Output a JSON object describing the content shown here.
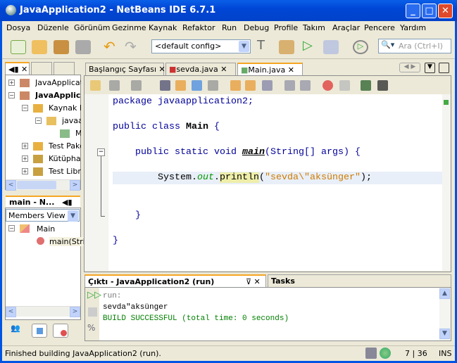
{
  "window": {
    "title": "JavaApplication2 - NetBeans IDE 6.7.1"
  },
  "menu": [
    "Dosya",
    "Düzenle",
    "Görünüm",
    "Gezinme",
    "Kaynak",
    "Refaktor",
    "Run",
    "Debug",
    "Profile",
    "Takım",
    "Araçlar",
    "Pencere",
    "Yardım"
  ],
  "toolbar": {
    "config": "<default config>",
    "search_placeholder": "Ara (Ctrl+I)"
  },
  "projects": {
    "items": [
      "JavaApplicati",
      "JavaApplic",
      "Kaynak P",
      "javaa",
      "M",
      "Test Pake",
      "Kütüphar",
      "Test Libra"
    ]
  },
  "navigator": {
    "title": "main - N...",
    "view": "Members View",
    "items": [
      "Main",
      "main(Stri"
    ]
  },
  "editor": {
    "tabs": [
      "Başlangıç Sayfası",
      "sevda.java",
      "Main.java"
    ],
    "active_tab": "Main.java"
  },
  "code": [
    [
      {
        "t": "package javaapplication2;",
        "c": "kw"
      }
    ],
    [],
    [
      {
        "t": "public class ",
        "c": "kw"
      },
      {
        "t": "Main",
        "c": "b"
      },
      {
        "t": " {",
        "c": "kw"
      }
    ],
    [],
    [
      {
        "t": "    public static void ",
        "c": "kw"
      },
      {
        "t": "main",
        "c": "bi"
      },
      {
        "t": "(String[] args) {",
        "c": "kw"
      }
    ],
    [],
    [
      {
        "t": "        System.",
        "c": ""
      },
      {
        "t": "out",
        "c": "it"
      },
      {
        "t": ".",
        "c": ""
      },
      {
        "t": "println",
        "c": "hl"
      },
      {
        "t": "(",
        "c": ""
      },
      {
        "t": "\"sevda\\\"aksünger\"",
        "c": "str"
      },
      {
        "t": ");",
        "c": ""
      }
    ],
    [],
    [],
    [
      {
        "t": "    }",
        "c": "kw"
      }
    ],
    [],
    [
      {
        "t": "}",
        "c": "kw"
      }
    ]
  ],
  "output": {
    "tab": "Çıktı - JavaApplication2 (run)",
    "tasks_tab": "Tasks",
    "lines": [
      "run:",
      "sevda\"aksünger",
      "BUILD SUCCESSFUL (total time: 0 seconds)"
    ]
  },
  "status": {
    "message": "Finished building JavaApplication2 (run).",
    "position": "7 | 36",
    "mode": "INS"
  },
  "colors": {
    "title_bar": "#0054e3",
    "success": "#008000",
    "keyword": "#000099",
    "string": "#ce7b00"
  }
}
